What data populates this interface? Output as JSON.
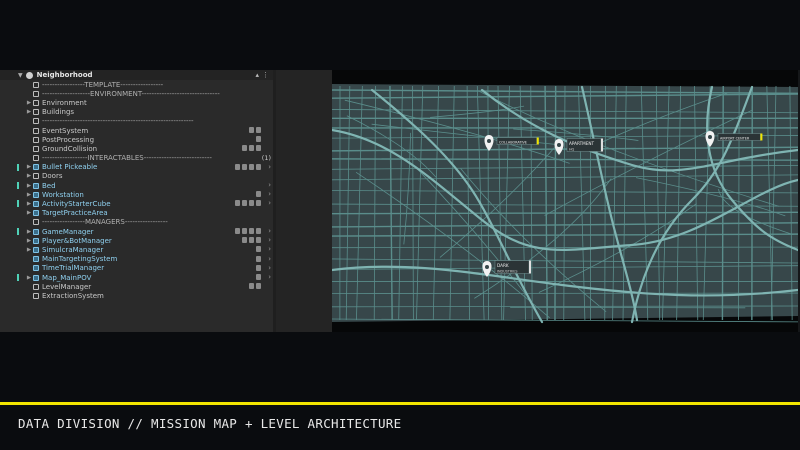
{
  "hierarchy": {
    "scene_name": "Neighborhood",
    "menu_glyph": "⋮",
    "collapse_glyph": "▴",
    "rows": [
      {
        "label": "-----------------TEMPLATE-----------------",
        "type": "sep",
        "arrow": false
      },
      {
        "label": "-------------------ENVIRONMENT-------------------------------",
        "type": "sep",
        "arrow": false
      },
      {
        "label": "Environment",
        "type": "obj",
        "arrow": true
      },
      {
        "label": "Buildings",
        "type": "obj",
        "arrow": true
      },
      {
        "label": "------------------------------------------------------------",
        "type": "sep",
        "arrow": false
      },
      {
        "label": "EventSystem",
        "type": "obj",
        "arrow": false,
        "badges": 2
      },
      {
        "label": "PostProcessing",
        "type": "obj",
        "arrow": false,
        "badges": 1
      },
      {
        "label": "GroundCollision",
        "type": "obj",
        "arrow": false,
        "badges": 3
      },
      {
        "label": "------------------INTERACTABLES---------------------------",
        "type": "sep",
        "arrow": false,
        "count": "(1)"
      },
      {
        "label": "Bullet Pickeable",
        "type": "prefab",
        "arrow": true,
        "badges": 4,
        "chev": true,
        "edge": true
      },
      {
        "label": "Doors",
        "type": "obj",
        "arrow": true
      },
      {
        "label": "Bed",
        "type": "prefab",
        "arrow": true,
        "chev": true,
        "edge": true
      },
      {
        "label": "Workstation",
        "type": "prefab",
        "arrow": true,
        "badges": 1,
        "chev": true
      },
      {
        "label": "ActivityStarterCube",
        "type": "prefab",
        "arrow": true,
        "badges": 4,
        "chev": true,
        "edge": true
      },
      {
        "label": "TargetPracticeArea",
        "type": "prefab",
        "arrow": true
      },
      {
        "label": "-----------------MANAGERS-----------------",
        "type": "sep",
        "arrow": false
      },
      {
        "label": "GameManager",
        "type": "prefab",
        "arrow": true,
        "badges": 4,
        "chev": true,
        "edge": true
      },
      {
        "label": "Player&BotManager",
        "type": "prefab",
        "arrow": true,
        "badges": 3,
        "chev": true
      },
      {
        "label": "SimulcraManager",
        "type": "prefab",
        "arrow": true,
        "badges": 1,
        "chev": true
      },
      {
        "label": "MainTargetingSystem",
        "type": "prefab",
        "arrow": false,
        "badges": 1,
        "chev": true
      },
      {
        "label": "TimeTrialManager",
        "type": "prefab",
        "arrow": false,
        "badges": 1,
        "chev": true
      },
      {
        "label": "Map_MainPOV",
        "type": "prefab",
        "arrow": true,
        "badges": 1,
        "chev": true,
        "edge": true
      },
      {
        "label": "LevelManager",
        "type": "obj",
        "arrow": false,
        "badges": 2
      },
      {
        "label": "ExtractionSystem",
        "type": "obj",
        "arrow": false
      }
    ]
  },
  "map": {
    "background": "#37474a",
    "road_color": "#5a8d8b",
    "highway_color": "#7fb4b2",
    "pins": [
      {
        "name": "pin-collaborative",
        "label": "COLLABORATIVE"
      },
      {
        "name": "pin-apartment",
        "label": "APARTMENT",
        "sub": "HQ"
      },
      {
        "name": "pin-airport",
        "label": "AIRPORT CENTER"
      },
      {
        "name": "pin-dark",
        "label": "DARK",
        "sub": "INDUSTRIES"
      }
    ]
  },
  "caption": "DATA DIVISION // MISSION MAP + LEVEL ARCHITECTURE",
  "accent": "#f2e600"
}
